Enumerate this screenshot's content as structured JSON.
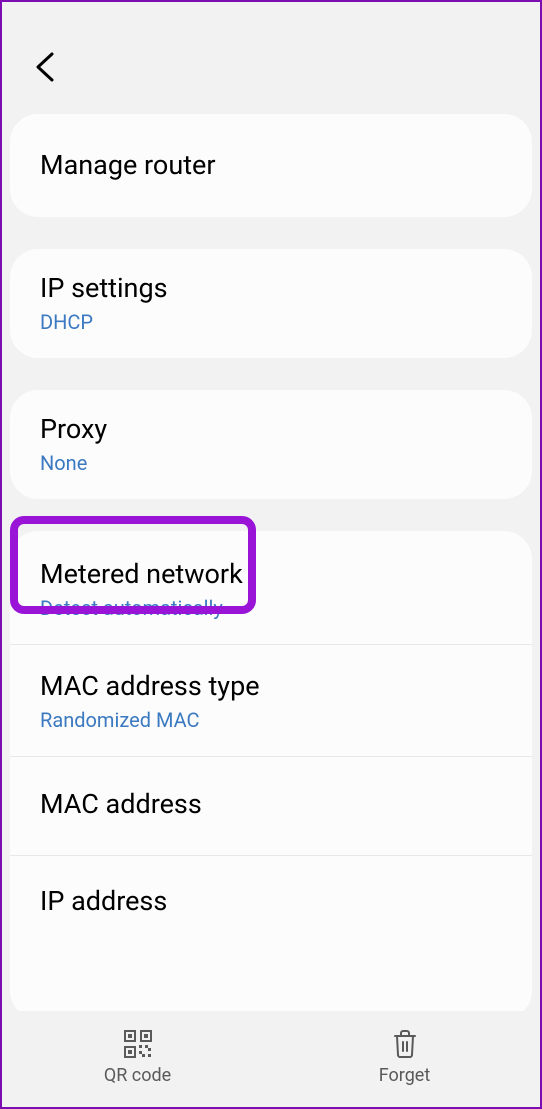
{
  "items": {
    "manage_router": {
      "title": "Manage router"
    },
    "ip_settings": {
      "title": "IP settings",
      "value": "DHCP"
    },
    "proxy": {
      "title": "Proxy",
      "value": "None"
    },
    "metered": {
      "title": "Metered network",
      "value": "Detect automatically"
    },
    "mac_type": {
      "title": "MAC address type",
      "value": "Randomized MAC"
    },
    "mac_address": {
      "title": "MAC address"
    },
    "ip_address": {
      "title": "IP address"
    }
  },
  "bottom": {
    "qr": "QR code",
    "forget": "Forget"
  }
}
